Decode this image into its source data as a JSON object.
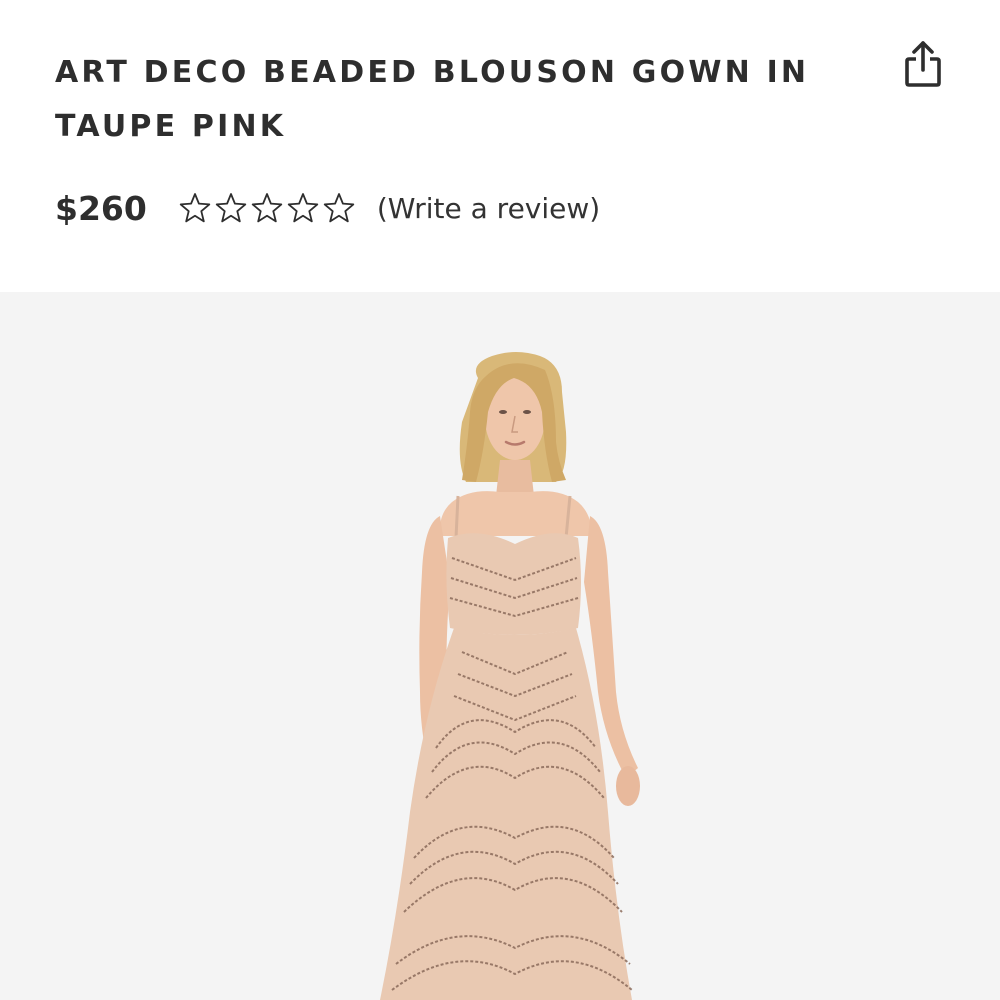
{
  "product": {
    "title": "ART DECO BEADED BLOUSON GOWN IN TAUPE PINK",
    "price": "$260",
    "rating": {
      "value": 0,
      "max": 5
    },
    "review_link": "(Write a review)"
  },
  "icons": {
    "share": "share-icon",
    "star": "star-outline-icon"
  },
  "colors": {
    "text": "#2e2e2e",
    "gallery_background": "#f4f4f4",
    "gown": "#e9c9b2",
    "beading": "#8a6a5a",
    "hair": "#d9b878",
    "skin": "#efc6aa"
  }
}
